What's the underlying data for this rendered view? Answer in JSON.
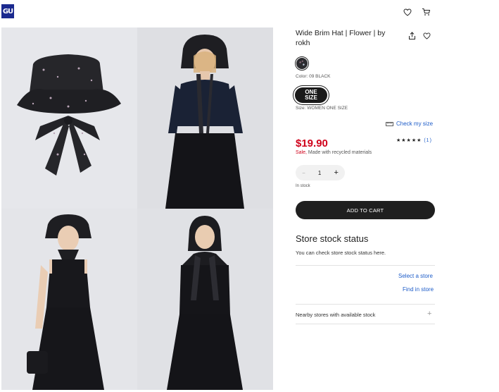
{
  "header": {
    "logo": "GU",
    "icons": [
      "heart-icon",
      "cart-icon"
    ]
  },
  "product": {
    "title": "Wide Brim Hat | Flower | by rokh",
    "color_label": "Color: 09 BLACK",
    "size_button": "ONE SIZE",
    "size_label": "Size: WOMEN ONE SIZE",
    "check_size": "Check my size",
    "price": "$19.90",
    "sale": "Sale,",
    "made_with": "Made with recycled materials",
    "rating_stars": "★★★★★",
    "rating_count": "(1)",
    "quantity": "1",
    "qty_minus": "−",
    "qty_plus": "+",
    "stock": "In stock",
    "add_to_cart": "ADD TO CART"
  },
  "store": {
    "title": "Store stock status",
    "description": "You can check store stock status here.",
    "select_store": "Select a store",
    "find_store": "Find in store",
    "nearby": "Nearby stores with available stock",
    "nearby_toggle": "+"
  },
  "colors": {
    "brand": "#1b2a8f",
    "sale_red": "#d0021b",
    "link_blue": "#1d5cc8"
  }
}
